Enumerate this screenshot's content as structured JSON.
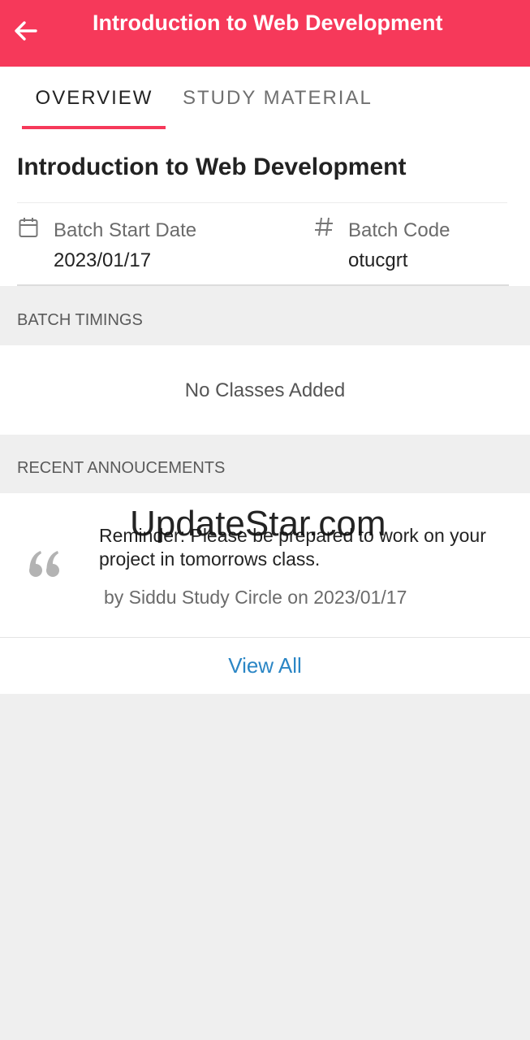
{
  "appbar": {
    "title": "Introduction to Web Development",
    "back_icon": "arrow-left-icon",
    "color": "#f6395a"
  },
  "tabs": [
    {
      "label": "OVERVIEW",
      "active": true
    },
    {
      "label": "STUDY MATERIAL",
      "active": false
    }
  ],
  "overview": {
    "course_title": "Introduction to Web Development",
    "batch_start": {
      "icon": "calendar-icon",
      "label": "Batch Start Date",
      "value": "2023/01/17"
    },
    "batch_code": {
      "icon": "hash-icon",
      "label": "Batch Code",
      "value": "otucgrt"
    }
  },
  "batch_timings": {
    "header": "BATCH TIMINGS",
    "empty_text": "No Classes Added"
  },
  "announcements": {
    "header": "RECENT ANNOUCEMENTS",
    "quote_icon": "quote-icon",
    "items": [
      {
        "text": "Reminder: Please be prepared to work on your project in tomorrows class.",
        "byline": "by Siddu Study Circle on 2023/01/17"
      }
    ],
    "view_all_label": "View All",
    "link_color": "#2b86c5"
  },
  "watermark": "UpdateStar.com"
}
